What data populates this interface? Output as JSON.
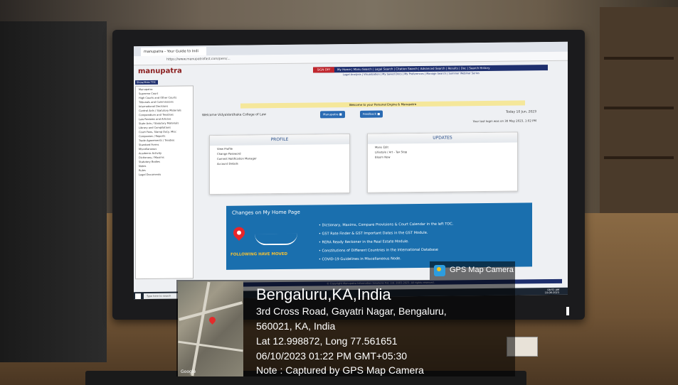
{
  "browser": {
    "tab_title": "manupatra - Your Guide to Indi",
    "url": "https://www.manupatrafast.com/pers/..."
  },
  "site": {
    "logo": "manupatra",
    "signout": "SIGN OFF",
    "nav": "My Home | Manu Search | Legal Search | Citation Search | Advanced Search | Results | Doc | Search History",
    "subnav": "Legal Analysis | Visualization | My Saved Docs | My Preferences | Manage Search | Summer Webinar Series",
    "toc_label": "Show/Hide TOC",
    "toc_items": [
      "Manupatra",
      "Supreme Court",
      "High Courts and Other Courts",
      "Tribunals and Commissions",
      "International Decisions",
      "Central Acts / Statutory Materials",
      "Compendium and Treatises",
      "Law Reviews and Articles",
      "State Acts / Statutory Materials",
      "Library and Compilations",
      "Court Fees, Stamp Duty, Misc",
      "Companies / Reports",
      "Trade Agreements / Treaties",
      "Standard Forms",
      "Miscellaneous",
      "Academic Activity",
      "Dictionary / Maxims",
      "Statutory Bodies",
      "Notes",
      "Rules",
      "Legal Documents"
    ],
    "notice": "Welcome to your Personal Engine & Manupatra",
    "welcome": "Welcome VidyaVardhaka College of Law",
    "btn_manupatra": "Manupatra ■",
    "btn_feedback": "Feedback ■",
    "today": "Today 10 Jun, 2023",
    "last_login": "Your last login was on 30 May 2023, 1:02 PM",
    "profile": {
      "title": "PROFILE",
      "items": [
        "View Profile",
        "Change Password",
        "Commit Notification Manager",
        "Account Details"
      ]
    },
    "updates": {
      "title": "UPDATES",
      "items": [
        "Manu Edit",
        "Lifestyle / Art - Tax Stop",
        "Bloom Now"
      ]
    },
    "changes": {
      "title": "Changes on My Home Page",
      "items": [
        "• Dictionary, Maxims, Compare Provisions & Court Calendar in the left TOC.",
        "• GST Rate Finder & GST Important Dates in the GST Module.",
        "• RERA Ready Reckoner in the Real Estate Module.",
        "• Constitutions of Different Countries in the International Database",
        "• COVID-19 Guidelines in Miscellaneous Node."
      ],
      "moved": "FOLLOWING HAVE MOVED"
    },
    "footer": "© Copyright Manupatra Information Solutions Pvt. Ltd. 2003-2023. All rights reserved."
  },
  "taskbar": {
    "search": "Type here to search",
    "time": "08:52 AM",
    "date": "10-06-2023"
  },
  "gps": {
    "badge": "GPS Map Camera",
    "city": "Bengaluru,KA,India",
    "address1": "3rd Cross Road, Gayatri Nagar, Bengaluru,",
    "address2": "560021, KA, India",
    "latlong": "Lat 12.998872, Long 77.561651",
    "datetime": "06/10/2023 01:22 PM GMT+05:30",
    "note": "Note : Captured by GPS Map Camera",
    "map_logo": "Google"
  }
}
